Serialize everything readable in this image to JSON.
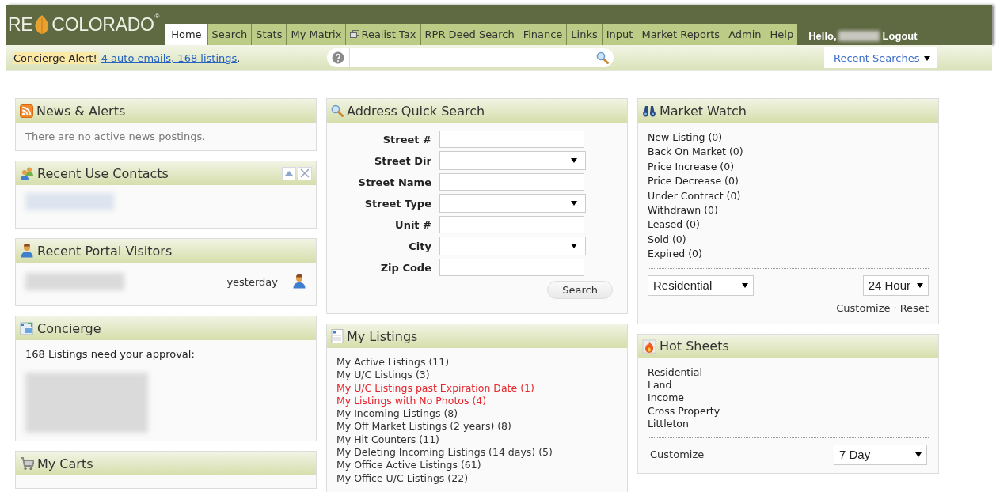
{
  "header": {
    "logo": {
      "left": "RE",
      "right": "COLORADO",
      "mark": "®"
    },
    "tabs": [
      {
        "label": "Home",
        "kind": "plain",
        "selected": true
      },
      {
        "label": "Search",
        "kind": "plain",
        "selected": false
      },
      {
        "label": "Stats",
        "kind": "plain",
        "selected": false
      },
      {
        "label": "My Matrix",
        "kind": "plain",
        "selected": false
      },
      {
        "label": "Realist Tax",
        "kind": "window",
        "selected": false
      },
      {
        "label": "RPR Deed Search",
        "kind": "plain",
        "selected": false
      },
      {
        "label": "Finance",
        "kind": "plain",
        "selected": false
      },
      {
        "label": "Links",
        "kind": "plain",
        "selected": false
      },
      {
        "label": "Input",
        "kind": "plain",
        "selected": false
      },
      {
        "label": "Market Reports",
        "kind": "plain",
        "selected": false
      },
      {
        "label": "Admin",
        "kind": "plain",
        "selected": false
      },
      {
        "label": "Help",
        "kind": "plain",
        "selected": false
      }
    ],
    "greeting": "Hello,",
    "logout": "Logout"
  },
  "alert_bar": {
    "label": "Concierge Alert!",
    "link": "4 auto emails, 168 listings",
    "trail": ".",
    "recent_searches": "Recent Searches"
  },
  "columns": [
    [
      {
        "kind": "message",
        "title": "News & Alerts",
        "text": "There are no active news postings."
      },
      {
        "kind": "contacts",
        "title": "Recent Use Contacts"
      },
      {
        "kind": "visitors",
        "title": "Recent Portal Visitors",
        "visitors": [
          {
            "when": "yesterday"
          }
        ]
      },
      {
        "kind": "concierge",
        "title": "Concierge",
        "text": "168 Listings need your approval:"
      },
      {
        "kind": "empty",
        "title": "My Carts"
      }
    ],
    [
      {
        "kind": "form",
        "title": "Address Quick Search",
        "fields": [
          {
            "label": "Street #",
            "kind": "text"
          },
          {
            "label": "Street Dir",
            "kind": "select"
          },
          {
            "label": "Street Name",
            "kind": "text"
          },
          {
            "label": "Street Type",
            "kind": "select"
          },
          {
            "label": "Unit #",
            "kind": "text"
          },
          {
            "label": "City",
            "kind": "select"
          },
          {
            "label": "Zip Code",
            "kind": "text"
          }
        ],
        "button": "Search"
      },
      {
        "kind": "links",
        "title": "My Listings",
        "items": [
          {
            "text": "My Active Listings (11)",
            "alert": false
          },
          {
            "text": "My U/C Listings (3)",
            "alert": false
          },
          {
            "text": "My U/C Listings past Expiration Date (1)",
            "alert": true
          },
          {
            "text": "My Listings with No Photos (4)",
            "alert": true
          },
          {
            "text": "My Incoming Listings (8)",
            "alert": false
          },
          {
            "text": "My Off Market Listings (2 years) (8)",
            "alert": false
          },
          {
            "text": "My Hit Counters (11)",
            "alert": false
          },
          {
            "text": "My Deleting Incoming Listings (14 days) (5)",
            "alert": false
          },
          {
            "text": "My Office Active Listings (61)",
            "alert": false
          },
          {
            "text": "My Office U/C Listings (22)",
            "alert": false
          }
        ]
      }
    ],
    [
      {
        "kind": "watch",
        "title": "Market Watch",
        "items": [
          "New Listing (0)",
          "Back On Market (0)",
          "Price Increase (0)",
          "Price Decrease (0)",
          "Under Contract (0)",
          "Withdrawn (0)",
          "Leased (0)",
          "Sold (0)",
          "Expired (0)"
        ],
        "type_select": "Residential",
        "period_select": "24 Hour",
        "customize": "Customize",
        "separator": "·",
        "reset": "Reset"
      },
      {
        "kind": "hotsheets",
        "title": "Hot Sheets",
        "items": [
          "Residential",
          "Land",
          "Income",
          "Cross Property",
          "Littleton"
        ],
        "customize": "Customize",
        "period_select": "7 Day"
      }
    ]
  ]
}
